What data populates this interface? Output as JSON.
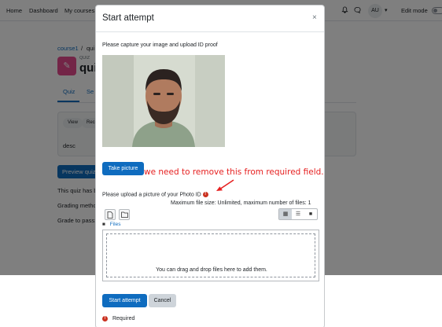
{
  "navbar": {
    "links": [
      "Home",
      "Dashboard",
      "My courses"
    ],
    "avatar_initials": "AU",
    "edit_mode_label": "Edit mode"
  },
  "background": {
    "breadcrumb_course": "course1",
    "breadcrumb_sep": "/",
    "breadcrumb_current": "qui",
    "quiz_small_label": "QUIZ",
    "quiz_title": "qui",
    "tabs": [
      "Quiz",
      "Se"
    ],
    "pills": [
      "View",
      "Rece"
    ],
    "desc": "desc",
    "preview_button": "Preview quiz",
    "lines": [
      "This quiz has b",
      "Grading metho",
      "Grade to pass:"
    ]
  },
  "modal": {
    "title": "Start attempt",
    "close_glyph": "×",
    "capture_instruction": "Please capture your image and upload ID proof",
    "take_picture_button": "Take picture",
    "annotation_text": "we need to remove this from required field.",
    "upload_label": "Please upload a picture of your Photo ID",
    "max_info": "Maximum file size: Unlimited, maximum number of files: 1",
    "files_label": "Files",
    "dropzone_text": "You can drag and drop files here to add them.",
    "start_button": "Start attempt",
    "cancel_button": "Cancel",
    "required_label": "Required"
  },
  "colors": {
    "primary": "#0f6cbf",
    "required": "#ca3120",
    "annotation": "#e62020"
  },
  "icons": [
    "bell-icon",
    "chat-icon",
    "chevron-down-icon",
    "add-file-icon",
    "folder-icon",
    "grid-view-icon",
    "list-view-icon",
    "tree-view-icon",
    "required-icon",
    "arrow-annotation"
  ]
}
